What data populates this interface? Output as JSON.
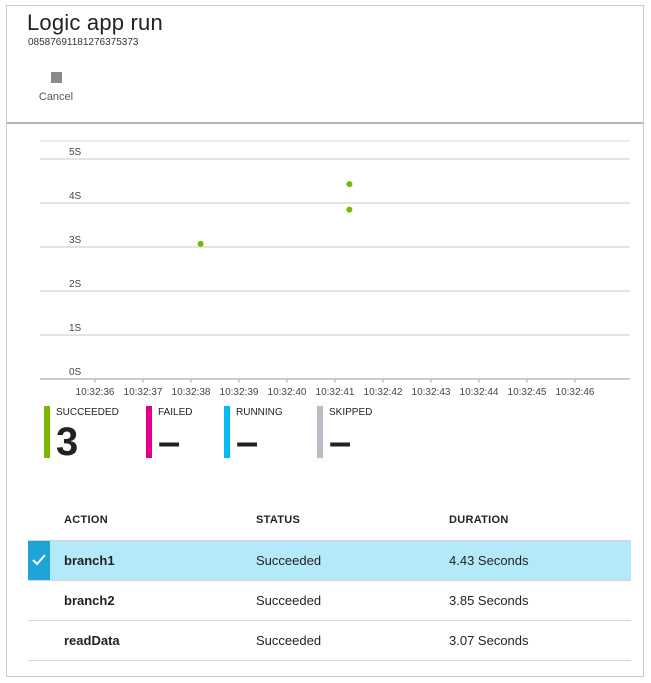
{
  "blade": {
    "title": "Logic app run",
    "run_id": "08587691181276375373",
    "commands": [
      {
        "label": "Cancel",
        "icon": "stop-icon"
      }
    ]
  },
  "chart_data": {
    "type": "scatter",
    "ylabel": "",
    "xlabel": "",
    "yticks": [
      "0S",
      "1S",
      "2S",
      "3S",
      "4S",
      "5S"
    ],
    "ylim": [
      0,
      5
    ],
    "xticks": [
      "10:32:36",
      "10:32:37",
      "10:32:38",
      "10:32:39",
      "10:32:40",
      "10:32:41",
      "10:32:42",
      "10:32:43",
      "10:32:44",
      "10:32:45",
      "10:32:46"
    ],
    "points": [
      {
        "x": "10:32:38.2",
        "y": 3.07
      },
      {
        "x": "10:32:41.3",
        "y": 3.85
      },
      {
        "x": "10:32:41.3",
        "y": 4.43
      }
    ],
    "point_color": "#7ab800",
    "grid": true
  },
  "summary": [
    {
      "label": "SUCCEEDED",
      "value": "3",
      "color": "#7ab800"
    },
    {
      "label": "FAILED",
      "value": "–",
      "color": "#e3008c"
    },
    {
      "label": "RUNNING",
      "value": "–",
      "color": "#00bcf2"
    },
    {
      "label": "SKIPPED",
      "value": "–",
      "color": "#b7bcc6"
    }
  ],
  "table": {
    "columns": [
      "ACTION",
      "STATUS",
      "DURATION"
    ],
    "rows": [
      {
        "action": "branch1",
        "status": "Succeeded",
        "duration": "4.43 Seconds",
        "selected": true
      },
      {
        "action": "branch2",
        "status": "Succeeded",
        "duration": "3.85 Seconds",
        "selected": false
      },
      {
        "action": "readData",
        "status": "Succeeded",
        "duration": "3.07 Seconds",
        "selected": false
      }
    ]
  }
}
